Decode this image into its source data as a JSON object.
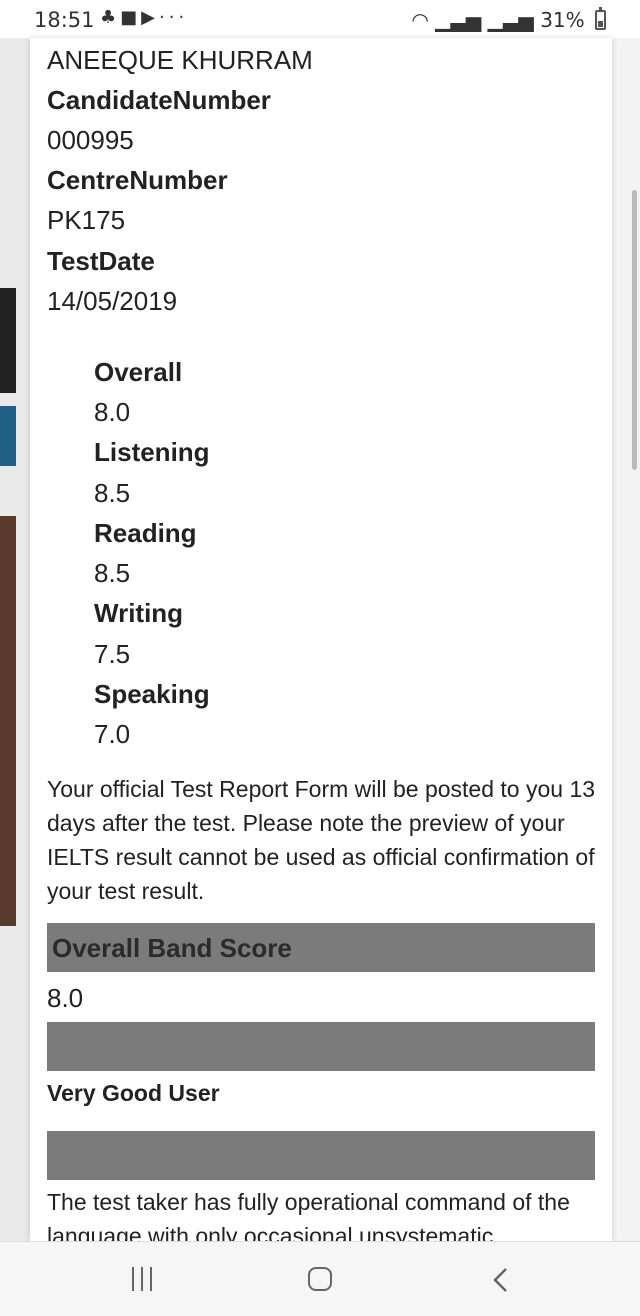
{
  "status_bar": {
    "time": "18:51",
    "notification_icons": [
      "usb-debug-icon",
      "chat-icon",
      "youtube-icon",
      "more-icon"
    ],
    "more": "···",
    "battery_percent": "31%"
  },
  "candidate": {
    "name": "ANEEQUE KHURRAM",
    "candidate_number_label": "CandidateNumber",
    "candidate_number": "000995",
    "centre_number_label": "CentreNumber",
    "centre_number": "PK175",
    "test_date_label": "TestDate",
    "test_date": "14/05/2019"
  },
  "scores": [
    {
      "label": "Overall",
      "value": "8.0"
    },
    {
      "label": "Listening",
      "value": "8.5"
    },
    {
      "label": "Reading",
      "value": "8.5"
    },
    {
      "label": "Writing",
      "value": "7.5"
    },
    {
      "label": "Speaking",
      "value": "7.0"
    }
  ],
  "note": "Your official Test Report Form will be posted to you 13 days after the test. Please note the preview of your IELTS result cannot be used as official confirmation of your test result.",
  "band": {
    "title": "Overall Band Score",
    "value": "8.0",
    "user_level": "Very Good User",
    "description": "The test taker has fully operational command of the language with only occasional unsystematic"
  },
  "colors": {
    "header_bar": "#7b7b7b",
    "text": "#222222"
  }
}
